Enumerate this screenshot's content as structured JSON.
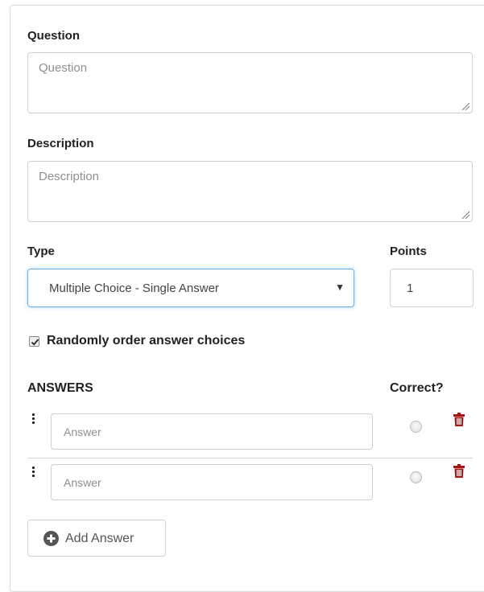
{
  "question": {
    "label": "Question",
    "placeholder": "Question"
  },
  "description": {
    "label": "Description",
    "placeholder": "Description"
  },
  "type": {
    "label": "Type",
    "selected": "Multiple Choice - Single Answer",
    "caret": "▼"
  },
  "points": {
    "label": "Points",
    "value": "1"
  },
  "randomize": {
    "label": "Randomly order answer choices",
    "checked": true
  },
  "answers": {
    "heading": "ANSWERS",
    "correct_label": "Correct?",
    "items": [
      {
        "placeholder": "Answer"
      },
      {
        "placeholder": "Answer"
      }
    ],
    "add_label": "Add Answer"
  },
  "colors": {
    "focus_border": "#66afe9",
    "trash": "#a31515",
    "plus_icon": "#555555"
  },
  "icons": [
    "drag-handle-icon",
    "trash-icon",
    "plus-circle-icon",
    "checkbox-checked-icon",
    "resize-grip-icon"
  ]
}
